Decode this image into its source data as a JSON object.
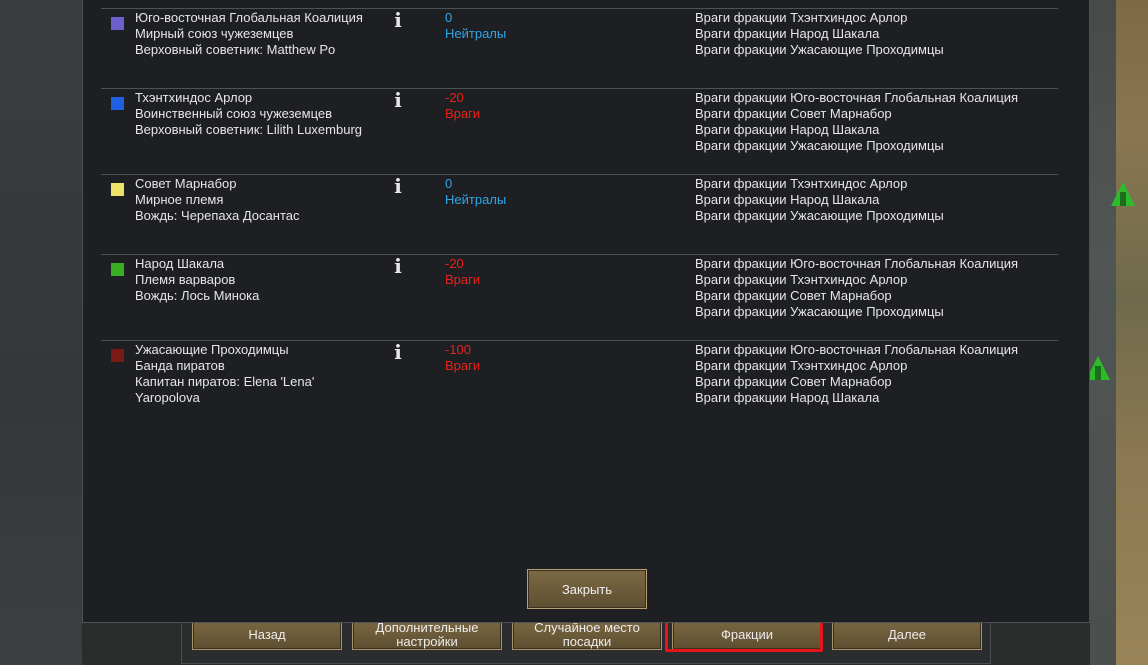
{
  "factions": [
    {
      "name": "Юго-восточная Глобальная Коалиция",
      "type": "Мирный союз чужеземцев",
      "leader": "Верховный советник: Matthew Po",
      "leader2": "",
      "color": "#6f5fcc",
      "goodwill": "0",
      "relation": "Нейтралы",
      "relation_kind": "neutral",
      "enemies": [
        "Враги фракции Тхэнтхиндос Арлор",
        "Враги фракции Народ Шакала",
        "Враги фракции Ужасающие Проходимцы"
      ]
    },
    {
      "name": "Тхэнтхиндос Арлор",
      "type": "Воинственный союз чужеземцев",
      "leader": "Верховный советник: Lilith Luxemburg",
      "leader2": "",
      "color": "#1f5fe0",
      "goodwill": "-20",
      "relation": "Враги",
      "relation_kind": "hostile",
      "enemies": [
        "Враги фракции Юго-восточная Глобальная Коалиция",
        "Враги фракции Совет Марнабор",
        "Враги фракции Народ Шакала",
        "Враги фракции Ужасающие Проходимцы"
      ]
    },
    {
      "name": "Совет Марнабор",
      "type": "Мирное племя",
      "leader": "Вождь: Черепаха Досантас",
      "leader2": "",
      "color": "#ece26a",
      "goodwill": "0",
      "relation": "Нейтралы",
      "relation_kind": "neutral",
      "enemies": [
        "Враги фракции Тхэнтхиндос Арлор",
        "Враги фракции Народ Шакала",
        "Враги фракции Ужасающие Проходимцы"
      ]
    },
    {
      "name": "Народ Шакала",
      "type": "Племя варваров",
      "leader": "Вождь: Лось Минока",
      "leader2": "",
      "color": "#3aae22",
      "goodwill": "-20",
      "relation": "Враги",
      "relation_kind": "hostile",
      "enemies": [
        "Враги фракции Юго-восточная Глобальная Коалиция",
        "Враги фракции Тхэнтхиндос Арлор",
        "Враги фракции Совет Марнабор",
        "Враги фракции Ужасающие Проходимцы"
      ]
    },
    {
      "name": "Ужасающие Проходимцы",
      "type": "Банда пиратов",
      "leader": "Капитан пиратов: Elena 'Lena'",
      "leader2": "Yaropolova",
      "color": "#7a1a14",
      "goodwill": "-100",
      "relation": "Враги",
      "relation_kind": "hostile",
      "enemies": [
        "Враги фракции Юго-восточная Глобальная Коалиция",
        "Враги фракции Тхэнтхиндос Арлор",
        "Враги фракции Совет Марнабор",
        "Враги фракции Народ Шакала"
      ]
    }
  ],
  "dialog": {
    "close_label": "Закрыть"
  },
  "bottom_bar": {
    "back_label": "Назад",
    "advanced_label_1": "Дополнительные",
    "advanced_label_2": "настройки",
    "random_site_label_1": "Случайное место",
    "random_site_label_2": "посадки",
    "factions_label": "Фракции",
    "next_label": "Далее"
  },
  "colors": {
    "highlight": "#e8141a",
    "neutral": "#2ea6e8",
    "hostile": "#e8221c"
  }
}
